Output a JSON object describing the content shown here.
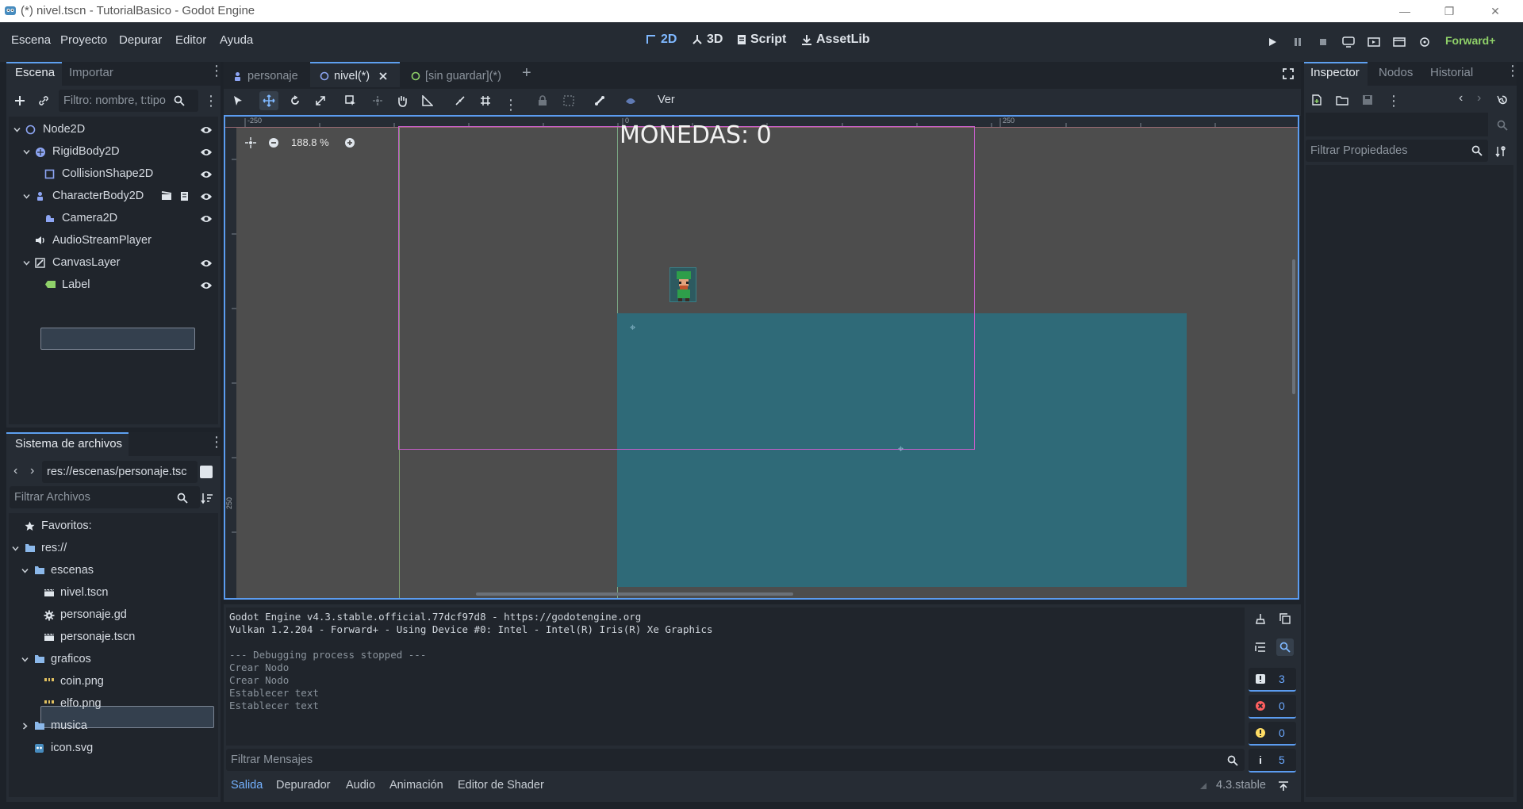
{
  "window": {
    "title": "(*) nivel.tscn - TutorialBasico - Godot Engine",
    "controls": [
      "—",
      "❐",
      "✕"
    ]
  },
  "menu": [
    "Escena",
    "Proyecto",
    "Depurar",
    "Editor",
    "Ayuda"
  ],
  "workspaces": [
    {
      "label": "2D",
      "active": true
    },
    {
      "label": "3D",
      "active": false
    },
    {
      "label": "Script",
      "active": false
    },
    {
      "label": "AssetLib",
      "active": false
    }
  ],
  "renderer": "Forward+",
  "scene_dock": {
    "tabs": [
      "Escena",
      "Importar"
    ],
    "filter_placeholder": "Filtro: nombre, t:tipo",
    "nodes": [
      {
        "name": "Node2D",
        "icon": "node2d-icon",
        "indent": 0,
        "expander": "open",
        "visible": true
      },
      {
        "name": "RigidBody2D",
        "icon": "rigidbody-icon",
        "indent": 1,
        "expander": "open",
        "visible": true
      },
      {
        "name": "CollisionShape2D",
        "icon": "collision-shape-icon",
        "indent": 2,
        "expander": "",
        "visible": true
      },
      {
        "name": "CharacterBody2D",
        "icon": "character-body-icon",
        "indent": 1,
        "expander": "open",
        "visible": true
      },
      {
        "name": "Camera2D",
        "icon": "camera-icon",
        "indent": 2,
        "expander": "",
        "visible": true
      },
      {
        "name": "AudioStreamPlayer",
        "icon": "audio-icon",
        "indent": 1,
        "expander": "",
        "visible": false
      },
      {
        "name": "CanvasLayer",
        "icon": "canvas-layer-icon",
        "indent": 1,
        "expander": "open",
        "visible": true
      },
      {
        "name": "Label",
        "icon": "label-icon",
        "indent": 2,
        "expander": "",
        "visible": true,
        "selected": true
      }
    ]
  },
  "filesystem_dock": {
    "tab": "Sistema de archivos",
    "path": "res://escenas/personaje.tsc",
    "filter_placeholder": "Filtrar Archivos",
    "items": [
      {
        "name": "Favoritos:",
        "icon": "star-icon",
        "indent": 0
      },
      {
        "name": "res://",
        "icon": "folder-icon",
        "indent": 0
      },
      {
        "name": "escenas",
        "icon": "folder-icon",
        "indent": 1
      },
      {
        "name": "nivel.tscn",
        "icon": "scene-file-icon",
        "indent": 2
      },
      {
        "name": "personaje.gd",
        "icon": "gear-icon",
        "indent": 2
      },
      {
        "name": "personaje.tscn",
        "icon": "scene-file-icon",
        "indent": 2,
        "selected": true
      },
      {
        "name": "graficos",
        "icon": "folder-icon",
        "indent": 1
      },
      {
        "name": "coin.png",
        "icon": "image-file-icon",
        "indent": 2
      },
      {
        "name": "elfo.png",
        "icon": "image-file-icon",
        "indent": 2
      },
      {
        "name": "musica",
        "icon": "folder-icon",
        "indent": 1
      },
      {
        "name": "icon.svg",
        "icon": "svg-file-icon",
        "indent": 1
      }
    ]
  },
  "editor_tabs": [
    {
      "label": "personaje",
      "active": false
    },
    {
      "label": "nivel(*)",
      "active": true
    },
    {
      "label": "[sin guardar](*)",
      "active": false
    }
  ],
  "toolbar": {
    "view_label": "Ver"
  },
  "viewport": {
    "zoom": "188.8 %",
    "ruler_labels": [
      "-250",
      "0",
      "250"
    ],
    "vertical_ruler_label": "250",
    "label_text": "MONEDAS: 0"
  },
  "output": {
    "lines": [
      "Godot Engine v4.3.stable.official.77dcf97d8 - https://godotengine.org",
      "Vulkan 1.2.204 - Forward+ - Using Device #0: Intel - Intel(R) Iris(R) Xe Graphics",
      "",
      "--- Debugging process stopped ---",
      "Crear Nodo",
      "Crear Nodo",
      "Establecer text",
      "Establecer text"
    ],
    "filter_placeholder": "Filtrar Mensajes",
    "counters": {
      "messages": "3",
      "errors": "0",
      "warnings": "0",
      "info": "5"
    }
  },
  "bottom_tabs": [
    "Salida",
    "Depurador",
    "Audio",
    "Animación",
    "Editor de Shader"
  ],
  "version": "4.3.stable",
  "inspector": {
    "tabs": [
      "Inspector",
      "Nodos",
      "Historial"
    ],
    "filter_placeholder": "Filtrar Propiedades"
  },
  "colors": {
    "accent": "#5ea0f0",
    "renderer": "#8fd169",
    "viewport_bg": "#4d4d4d",
    "rigid_body_fill": "#2f6a78"
  }
}
